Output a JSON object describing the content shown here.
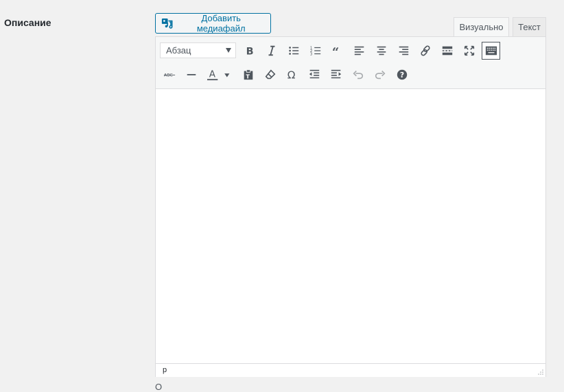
{
  "field": {
    "label": "Описание"
  },
  "media_button": {
    "label": "Добавить медиафайл",
    "icon": "media-add-icon"
  },
  "tabs": [
    {
      "label": "Визуально",
      "active": true
    },
    {
      "label": "Текст",
      "active": false
    }
  ],
  "toolbar": {
    "format_select": {
      "value": "Абзац"
    },
    "row1": [
      "bold-icon",
      "italic-icon",
      "bullet-list-icon",
      "numbered-list-icon",
      "blockquote-icon",
      "align-left-icon",
      "align-center-icon",
      "align-right-icon",
      "link-icon",
      "read-more-icon",
      "fullscreen-icon",
      "toolbar-toggle-icon"
    ],
    "row2": [
      "strikethrough-icon",
      "horizontal-line-icon",
      "text-color-icon",
      "paste-text-icon",
      "clear-formatting-icon",
      "special-character-icon",
      "outdent-icon",
      "indent-icon",
      "undo-icon",
      "redo-icon",
      "help-icon"
    ],
    "text_color_letter": "A",
    "strikethrough_text": "ABC",
    "omega": "Ω"
  },
  "statusbar": {
    "path": "p"
  },
  "colors": {
    "accent": "#0071a1",
    "icon": "#50575e",
    "border": "#dcdcde"
  },
  "below_text": "О"
}
